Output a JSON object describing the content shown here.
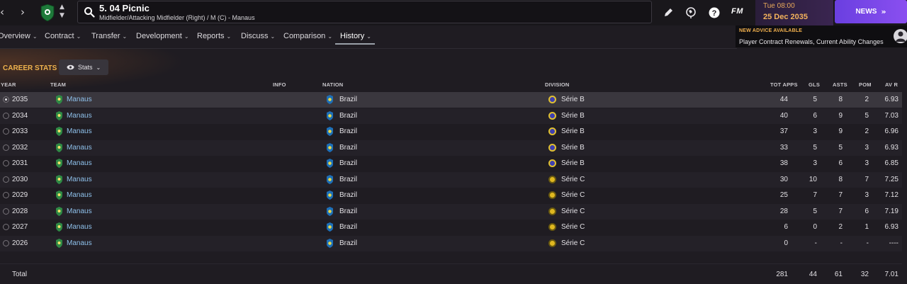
{
  "header": {
    "player_title": "5. 04 Picnic",
    "player_subtitle": "Midfielder/Attacking Midfielder (Right) / M (C) - Manaus",
    "fm_logo": "FM",
    "date_time": "Tue 08:00",
    "date_date": "25 Dec 2035",
    "news_label": "NEWS"
  },
  "tabs": [
    {
      "label": "Overview"
    },
    {
      "label": "Contract"
    },
    {
      "label": "Transfer"
    },
    {
      "label": "Development"
    },
    {
      "label": "Reports"
    },
    {
      "label": "Discuss"
    },
    {
      "label": "Comparison"
    },
    {
      "label": "History",
      "active": true
    }
  ],
  "advice": {
    "title": "NEW ADVICE AVAILABLE",
    "text": "Player Contract Renewals, Current Ability Changes"
  },
  "section": {
    "title": "CAREER STATS",
    "stats_button": "Stats"
  },
  "columns": {
    "year": "YEAR",
    "team": "TEAM",
    "info": "INFO",
    "nation": "NATION",
    "division": "DIVISION",
    "tot_apps": "TOT APPS",
    "gls": "GLS",
    "asts": "ASTS",
    "pom": "POM",
    "av_r": "AV R"
  },
  "rows": [
    {
      "year": "2035",
      "team": "Manaus",
      "nation": "Brazil",
      "division": "Série B",
      "apps": "44",
      "gls": "5",
      "asts": "8",
      "pom": "2",
      "avr": "6.93"
    },
    {
      "year": "2034",
      "team": "Manaus",
      "nation": "Brazil",
      "division": "Série B",
      "apps": "40",
      "gls": "6",
      "asts": "9",
      "pom": "5",
      "avr": "7.03"
    },
    {
      "year": "2033",
      "team": "Manaus",
      "nation": "Brazil",
      "division": "Série B",
      "apps": "37",
      "gls": "3",
      "asts": "9",
      "pom": "2",
      "avr": "6.96"
    },
    {
      "year": "2032",
      "team": "Manaus",
      "nation": "Brazil",
      "division": "Série B",
      "apps": "33",
      "gls": "5",
      "asts": "5",
      "pom": "3",
      "avr": "6.93"
    },
    {
      "year": "2031",
      "team": "Manaus",
      "nation": "Brazil",
      "division": "Série B",
      "apps": "38",
      "gls": "3",
      "asts": "6",
      "pom": "3",
      "avr": "6.85"
    },
    {
      "year": "2030",
      "team": "Manaus",
      "nation": "Brazil",
      "division": "Série C",
      "apps": "30",
      "gls": "10",
      "asts": "8",
      "pom": "7",
      "avr": "7.25"
    },
    {
      "year": "2029",
      "team": "Manaus",
      "nation": "Brazil",
      "division": "Série C",
      "apps": "25",
      "gls": "7",
      "asts": "7",
      "pom": "3",
      "avr": "7.12"
    },
    {
      "year": "2028",
      "team": "Manaus",
      "nation": "Brazil",
      "division": "Série C",
      "apps": "28",
      "gls": "5",
      "asts": "7",
      "pom": "6",
      "avr": "7.19"
    },
    {
      "year": "2027",
      "team": "Manaus",
      "nation": "Brazil",
      "division": "Série C",
      "apps": "6",
      "gls": "0",
      "asts": "2",
      "pom": "1",
      "avr": "6.93"
    },
    {
      "year": "2026",
      "team": "Manaus",
      "nation": "Brazil",
      "division": "Série C",
      "apps": "0",
      "gls": "-",
      "asts": "-",
      "pom": "-",
      "avr": "----"
    }
  ],
  "total": {
    "label": "Total",
    "apps": "281",
    "gls": "44",
    "asts": "61",
    "pom": "32",
    "avr": "7.01"
  },
  "colors": {
    "accent_orange": "#f0b34d",
    "team_link": "#8ec0ea",
    "news_purple": "#7a47e8",
    "serie_b_icon": "#3d3fb0",
    "serie_c_icon": "#e0b820"
  }
}
